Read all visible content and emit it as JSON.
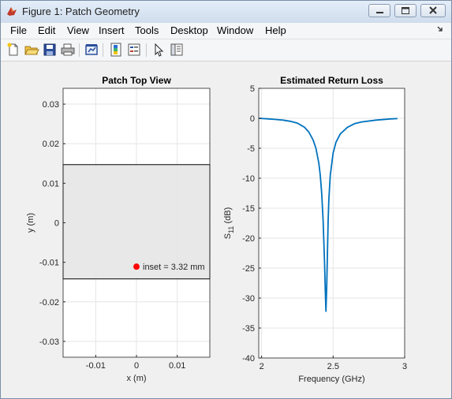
{
  "window": {
    "title": "Figure 1: Patch Geometry",
    "buttons": [
      "minimize",
      "maximize",
      "close"
    ]
  },
  "menubar": {
    "items": [
      "File",
      "Edit",
      "View",
      "Insert",
      "Tools",
      "Desktop",
      "Window",
      "Help"
    ]
  },
  "toolbar": {
    "icons": [
      "new-figure-icon",
      "open-file-icon",
      "save-icon",
      "print-icon",
      "link-plot-icon",
      "insert-colorbar-icon",
      "insert-legend-icon",
      "edit-plot-arrow-icon",
      "property-inspector-icon"
    ]
  },
  "chart_data": [
    {
      "type": "patch-geometry",
      "title": "Patch Top View",
      "xlabel": "x (m)",
      "ylabel": "y (m)",
      "xlim": [
        -0.018,
        0.018
      ],
      "ylim": [
        -0.034,
        0.034
      ],
      "xticks": [
        -0.01,
        0,
        0.01
      ],
      "xtick_labels": [
        "-0.01",
        "0",
        "0.01"
      ],
      "yticks": [
        0.03,
        0.02,
        0.01,
        0,
        -0.01,
        -0.02,
        -0.03
      ],
      "ytick_labels": [
        "0.03",
        "0.02",
        "0.01",
        "0",
        "-0.01",
        "-0.02",
        "-0.03"
      ],
      "grid": true,
      "patch": {
        "x": [
          -0.018,
          0.018
        ],
        "y": [
          -0.0142,
          0.0147
        ],
        "color": "#e5e5e5"
      },
      "feed_point": {
        "x": 0.0,
        "y": -0.0111,
        "color": "#ff0000"
      },
      "annotation": "inset = 3.32 mm"
    },
    {
      "type": "line",
      "title": "Estimated Return Loss",
      "xlabel": "Frequency (GHz)",
      "ylabel": "S11 (dB)",
      "ylabel_main": "S",
      "ylabel_sub": "11",
      "ylabel_unit": " (dB)",
      "xlim": [
        1.98,
        3.0
      ],
      "ylim": [
        -40,
        5
      ],
      "xticks": [
        2,
        2.5,
        3
      ],
      "xtick_labels": [
        "2",
        "2.5",
        "3"
      ],
      "yticks": [
        5,
        0,
        -5,
        -10,
        -15,
        -20,
        -25,
        -30,
        -35,
        -40
      ],
      "ytick_labels": [
        "5",
        "0",
        "-5",
        "-10",
        "-15",
        "-20",
        "-25",
        "-30",
        "-35",
        "-40"
      ],
      "grid": true,
      "series": [
        {
          "color": "#0072bd",
          "x": [
            1.98,
            2.05,
            2.1,
            2.15,
            2.2,
            2.25,
            2.3,
            2.33,
            2.36,
            2.38,
            2.4,
            2.41,
            2.42,
            2.43,
            2.44,
            2.445,
            2.45,
            2.455,
            2.46,
            2.465,
            2.47,
            2.48,
            2.5,
            2.52,
            2.55,
            2.6,
            2.65,
            2.7,
            2.8,
            2.9,
            2.95
          ],
          "y": [
            0,
            -0.1,
            -0.2,
            -0.3,
            -0.5,
            -0.8,
            -1.5,
            -2.3,
            -3.6,
            -5.0,
            -7.5,
            -9.5,
            -12.5,
            -17,
            -24,
            -28.5,
            -32.2,
            -28,
            -22.5,
            -17,
            -13.5,
            -9.5,
            -5.8,
            -4.0,
            -2.6,
            -1.5,
            -0.9,
            -0.6,
            -0.3,
            -0.1,
            -0.05
          ]
        }
      ]
    }
  ]
}
